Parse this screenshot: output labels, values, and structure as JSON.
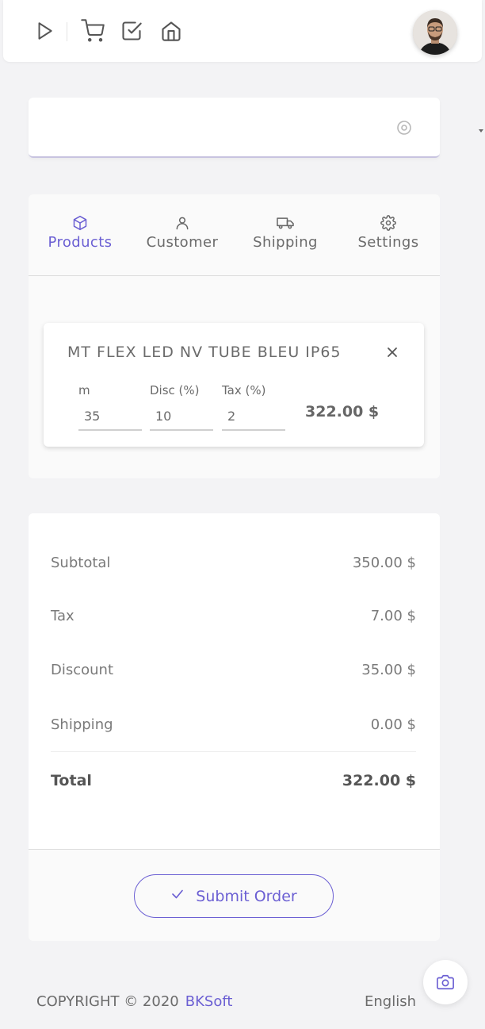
{
  "toolbar": {
    "icons": [
      "play-icon",
      "cart-icon",
      "checkbox-icon",
      "home-icon"
    ]
  },
  "search": {
    "placeholder": "",
    "value": ""
  },
  "tabs": [
    {
      "label": "Products",
      "icon": "box-icon",
      "active": true
    },
    {
      "label": "Customer",
      "icon": "user-icon",
      "active": false
    },
    {
      "label": "Shipping",
      "icon": "truck-icon",
      "active": false
    },
    {
      "label": "Settings",
      "icon": "gear-icon",
      "active": false
    }
  ],
  "item": {
    "title": "MT FLEX LED NV TUBE BLEU IP65",
    "qty_label": "m",
    "qty_value": "35",
    "disc_label": "Disc (%)",
    "disc_value": "10",
    "tax_label": "Tax (%)",
    "tax_value": "2",
    "line_total": "322.00 $"
  },
  "summary": {
    "subtotal_label": "Subtotal",
    "subtotal_value": "350.00 $",
    "tax_label": "Tax",
    "tax_value": "7.00 $",
    "discount_label": "Discount",
    "discount_value": "35.00 $",
    "shipping_label": "Shipping",
    "shipping_value": "0.00 $",
    "total_label": "Total",
    "total_value": "322.00 $"
  },
  "submit_label": "Submit Order",
  "footer": {
    "copyright": "COPYRIGHT © 2020",
    "brand": "BKSoft",
    "language": "English"
  },
  "colors": {
    "accent": "#6b5fd3",
    "background": "#f3f3f5",
    "text": "#6b6b6b"
  }
}
